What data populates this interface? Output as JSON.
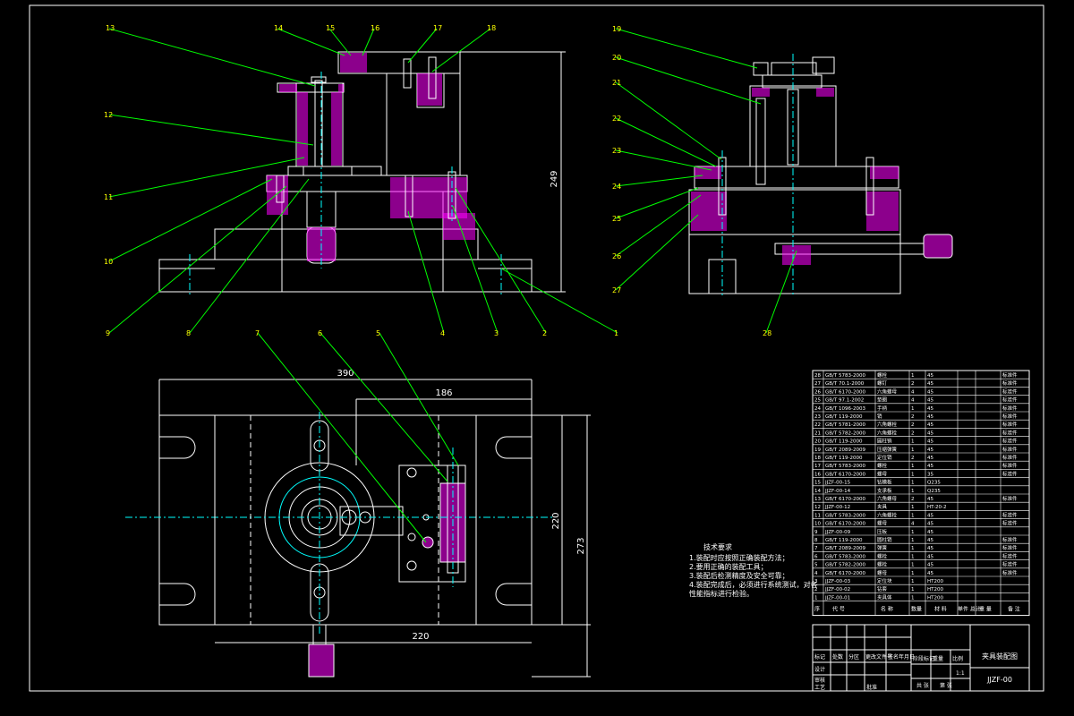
{
  "colors": {
    "background": "#000000",
    "outline": "#ffffff",
    "leader": "#00ff00",
    "centerline": "#00ffff",
    "section": "#ff00ff",
    "dimension": "#ffffff",
    "labels": "#ffff00"
  },
  "front_view_balloons": [
    "13",
    "14",
    "15",
    "16",
    "17",
    "18",
    "12",
    "11",
    "10",
    "9",
    "8",
    "4",
    "3",
    "2",
    "1"
  ],
  "side_view_balloons": [
    "19",
    "20",
    "21",
    "22",
    "23",
    "24",
    "25",
    "26",
    "27",
    "28"
  ],
  "top_view_balloons": [
    "7",
    "6",
    "5"
  ],
  "dimensions": {
    "height_front": "249",
    "width_total": "390",
    "width_partial": "186",
    "width_bottom": "220",
    "depth_inner": "220",
    "depth_total": "273"
  },
  "tech_requirements": {
    "title": "技术要求",
    "items": [
      "1.装配时应按照正确装配方法；",
      "2.要用正确的装配工具；",
      "3.装配后检测精度及安全可靠；",
      "4.装配完成后，必须进行系统测试，对各",
      "性能指标进行检验。"
    ]
  },
  "bom": {
    "header": [
      "序",
      "代 号",
      "名 称",
      "数量",
      "材 料",
      "单件 总计",
      "重 量",
      "备 注"
    ],
    "rows": [
      [
        "28",
        "GB/T 5783-2000",
        "螺栓",
        "1",
        "45",
        "",
        "标准件"
      ],
      [
        "27",
        "GB/T 70.1-2000",
        "螺钉",
        "2",
        "45",
        "",
        "标准件"
      ],
      [
        "26",
        "GB/T 6170-2000",
        "六角螺母",
        "4",
        "45",
        "",
        "标准件"
      ],
      [
        "25",
        "GB/T 97.1-2002",
        "垫圈",
        "4",
        "45",
        "",
        "标准件"
      ],
      [
        "24",
        "GB/T 1096-2003",
        "手柄",
        "1",
        "45",
        "",
        "标准件"
      ],
      [
        "23",
        "GB/T 119-2000",
        "销",
        "2",
        "45",
        "",
        "标准件"
      ],
      [
        "22",
        "GB/T 5781-2000",
        "六角螺栓",
        "2",
        "45",
        "",
        "标准件"
      ],
      [
        "21",
        "GB/T 5782-2000",
        "六角螺栓",
        "2",
        "45",
        "",
        "标准件"
      ],
      [
        "20",
        "GB/T 119-2000",
        "圆柱销",
        "1",
        "45",
        "",
        "标准件"
      ],
      [
        "19",
        "GB/T 2089-2009",
        "压缩弹簧",
        "1",
        "45",
        "",
        "标准件"
      ],
      [
        "18",
        "GB/T 119-2000",
        "定位销",
        "2",
        "45",
        "",
        "标准件"
      ],
      [
        "17",
        "GB/T 5783-2000",
        "螺栓",
        "1",
        "45",
        "",
        "标准件"
      ],
      [
        "16",
        "GB/T 6170-2000",
        "螺母",
        "1",
        "35",
        "",
        "标准件"
      ],
      [
        "15",
        "JJZF-00-15",
        "钻模板",
        "1",
        "Q235",
        "",
        ""
      ],
      [
        "14",
        "JJZF-00-14",
        "支承板",
        "1",
        "Q235",
        "",
        ""
      ],
      [
        "13",
        "GB/T 6170-2000",
        "六角螺母",
        "2",
        "45",
        "",
        "标准件"
      ],
      [
        "12",
        "JJZF-00-12",
        "夹具",
        "1",
        "HT-20-2",
        "",
        ""
      ],
      [
        "11",
        "GB/T 5783-2000",
        "六角螺栓",
        "1",
        "45",
        "",
        "标准件"
      ],
      [
        "10",
        "GB/T 6170-2000",
        "螺母",
        "4",
        "45",
        "",
        "标准件"
      ],
      [
        "9",
        "JJZF-00-09",
        "压板",
        "1",
        "45",
        "",
        ""
      ],
      [
        "8",
        "GB/T 119-2000",
        "圆柱销",
        "1",
        "45",
        "",
        "标准件"
      ],
      [
        "7",
        "GB/T 2089-2009",
        "弹簧",
        "1",
        "45",
        "",
        "标准件"
      ],
      [
        "6",
        "GB/T 5783-2000",
        "螺栓",
        "1",
        "45",
        "",
        "标准件"
      ],
      [
        "5",
        "GB/T 5782-2000",
        "螺栓",
        "1",
        "45",
        "",
        "标准件"
      ],
      [
        "4",
        "GB/T 6170-2000",
        "螺母",
        "1",
        "45",
        "",
        "标准件"
      ],
      [
        "3",
        "JJZF-00-03",
        "定位块",
        "1",
        "HT200",
        "",
        ""
      ],
      [
        "2",
        "JJZF-00-02",
        "钻套",
        "1",
        "HT200",
        "",
        ""
      ],
      [
        "1",
        "JJZF-00-01",
        "夹具体",
        "1",
        "HT200",
        "",
        ""
      ]
    ]
  },
  "title_block": {
    "drawing_name": "夹具装配图",
    "drawing_number": "JJZF-00",
    "labels_left": [
      "标记",
      "处数",
      "分区",
      "更改文件号",
      "签名",
      "年月日"
    ],
    "row_labels": [
      "设计",
      "审核",
      "工艺"
    ],
    "mid_labels": [
      "阶段标记",
      "重量",
      "比例"
    ],
    "bottom_labels": [
      "共 张",
      "第 张"
    ],
    "scale": "1:1",
    "sign_date": "批准"
  }
}
